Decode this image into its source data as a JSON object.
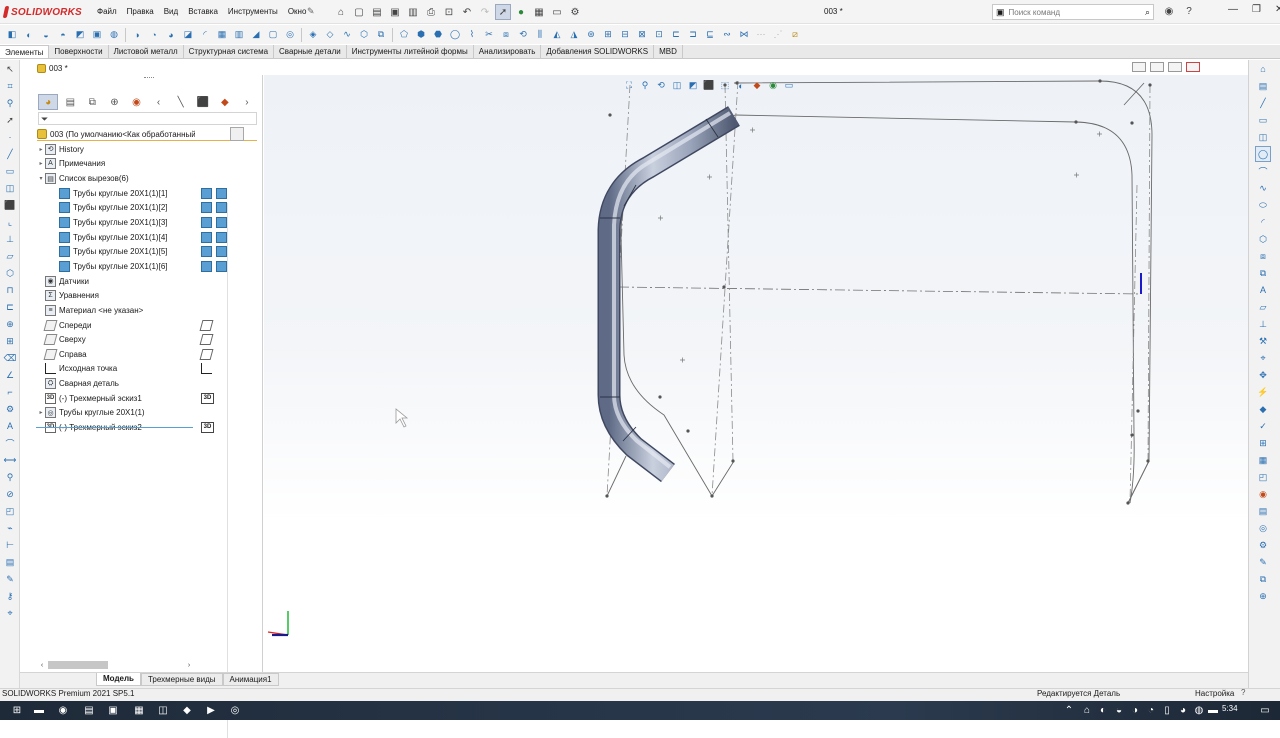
{
  "app": {
    "brand": "SOLIDWORKS",
    "document_title": "003 *",
    "menu": [
      "Файл",
      "Правка",
      "Вид",
      "Вставка",
      "Инструменты",
      "Окно"
    ],
    "search_placeholder": "Поиск команд"
  },
  "command_tabs": [
    "Элементы",
    "Поверхности",
    "Листовой металл",
    "Структурная система",
    "Сварные детали",
    "Инструменты литейной формы",
    "Анализировать",
    "Добавления SOLIDWORKS",
    "MBD"
  ],
  "doc_tab": "003 *",
  "feature_tree": {
    "root": "003  (По умолчанию<Как обработанный>)",
    "items": [
      {
        "label": "History",
        "icon": "history-folder-icon",
        "expand": "▸",
        "level": 0
      },
      {
        "label": "Примечания",
        "icon": "annotations-icon",
        "expand": "▸",
        "level": 0
      },
      {
        "label": "Список вырезов(6)",
        "icon": "cut-list-icon",
        "expand": "▾",
        "level": 0
      },
      {
        "label": "Трубы круглые 20X1(1)[1]",
        "icon": "solid-body-icon",
        "expand": "",
        "level": 1
      },
      {
        "label": "Трубы круглые 20X1(1)[2]",
        "icon": "solid-body-icon",
        "expand": "",
        "level": 1
      },
      {
        "label": "Трубы круглые 20X1(1)[3]",
        "icon": "solid-body-icon",
        "expand": "",
        "level": 1
      },
      {
        "label": "Трубы круглые 20X1(1)[4]",
        "icon": "solid-body-icon",
        "expand": "",
        "level": 1
      },
      {
        "label": "Трубы круглые 20X1(1)[5]",
        "icon": "solid-body-icon",
        "expand": "",
        "level": 1
      },
      {
        "label": "Трубы круглые 20X1(1)[6]",
        "icon": "solid-body-icon",
        "expand": "",
        "level": 1
      },
      {
        "label": "Датчики",
        "icon": "sensors-icon",
        "expand": "",
        "level": 0
      },
      {
        "label": "Уравнения",
        "icon": "equations-icon",
        "expand": "",
        "level": 0
      },
      {
        "label": "Материал <не указан>",
        "icon": "material-icon",
        "expand": "",
        "level": 0
      },
      {
        "label": "Спереди",
        "icon": "plane-icon",
        "expand": "",
        "level": 0
      },
      {
        "label": "Сверху",
        "icon": "plane-icon",
        "expand": "",
        "level": 0
      },
      {
        "label": "Справа",
        "icon": "plane-icon",
        "expand": "",
        "level": 0
      },
      {
        "label": "Исходная точка",
        "icon": "origin-icon",
        "expand": "",
        "level": 0
      },
      {
        "label": "Сварная деталь",
        "icon": "weldment-icon",
        "expand": "",
        "level": 0
      },
      {
        "label": "(-) Трехмерный эскиз1",
        "icon": "3d-sketch-icon",
        "expand": "",
        "level": 0
      },
      {
        "label": "Трубы круглые 20X1(1)",
        "icon": "structural-member-icon",
        "expand": "▸",
        "level": 0
      },
      {
        "label": "(-) Трехмерный эскиз2",
        "icon": "3d-sketch-icon",
        "expand": "",
        "level": 0
      }
    ]
  },
  "bottom_tabs": [
    "Модель",
    "Трехмерные виды",
    "Анимация1"
  ],
  "status": {
    "left": "SOLIDWORKS Premium 2021 SP5.1",
    "mid": "Редактируется Деталь",
    "right": "Настройка",
    "help": "?"
  },
  "clock": "5:34",
  "colors": {
    "brand_red": "#d42a2a",
    "tube": "#8d99b3",
    "accent_blue": "#2a6fb1"
  }
}
